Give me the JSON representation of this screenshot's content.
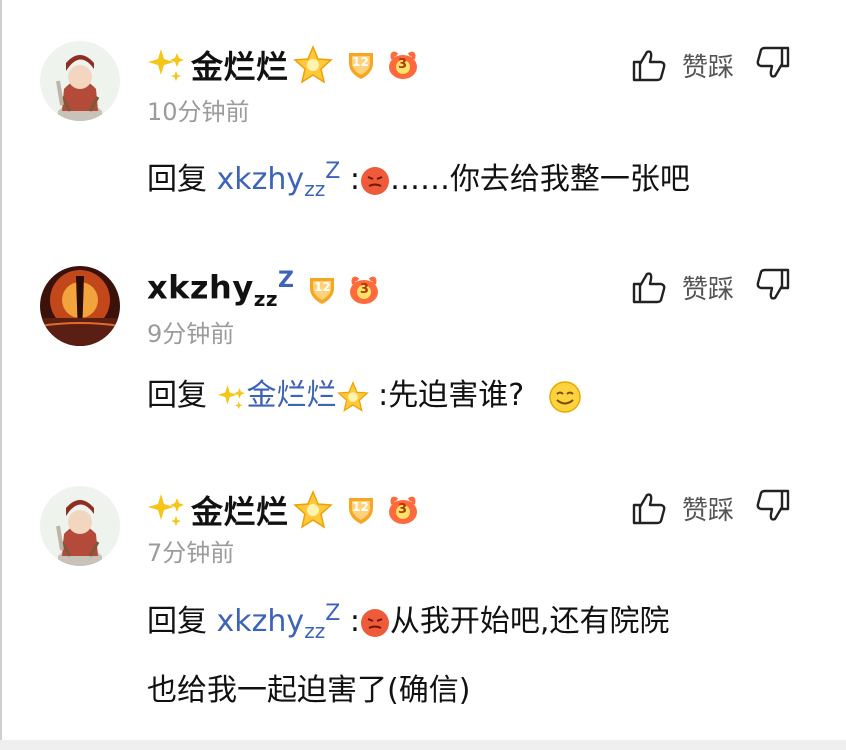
{
  "colors": {
    "link": "#3c63b8",
    "muted": "#9b9b9b",
    "badge": "#f6a623",
    "fire": "#ff6a3d"
  },
  "actions": {
    "like_label": "赞",
    "dislike_label": "踩",
    "like_icon": "thumbs-up-icon",
    "dislike_icon": "thumbs-down-icon"
  },
  "comments": [
    {
      "user": "金烂烂",
      "level_badge": "12",
      "rank_badge": "3",
      "time": "10分钟前",
      "reply_prefix": "回复",
      "reply_to": "xkzhy",
      "reply_to_zz": "zz",
      "reply_to_Z": "Z",
      "colon": ":",
      "text": "……你去给我整一张吧"
    },
    {
      "user": "xkzhy",
      "user_zz": "zz",
      "user_Z": "Z",
      "level_badge": "12",
      "rank_badge": "3",
      "time": "9分钟前",
      "reply_prefix": "回复",
      "reply_to": "金烂烂",
      "colon": ":",
      "text": ":先迫害谁?"
    },
    {
      "user": "金烂烂",
      "level_badge": "12",
      "rank_badge": "3",
      "time": "7分钟前",
      "reply_prefix": "回复",
      "reply_to": "xkzhy",
      "reply_to_zz": "zz",
      "reply_to_Z": "Z",
      "colon": ":",
      "text_line1": "从我开始吧,还有院院",
      "text_line2": "也给我一起迫害了(确信)"
    }
  ]
}
